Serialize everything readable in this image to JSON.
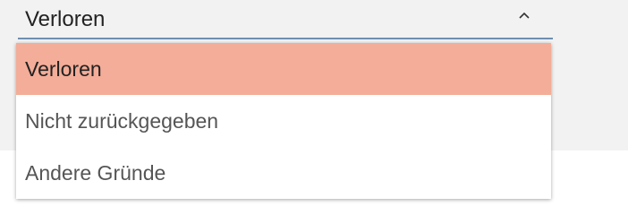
{
  "select": {
    "value": "Verloren",
    "icon": "chevron-up-icon",
    "underline_color": "#6d8fb0"
  },
  "dropdown": {
    "options": [
      {
        "label": "Verloren",
        "selected": true
      },
      {
        "label": "Nicht zurückgegeben",
        "selected": false
      },
      {
        "label": "Andere Gründe",
        "selected": false
      }
    ],
    "selected_color": "#f3ad98"
  }
}
